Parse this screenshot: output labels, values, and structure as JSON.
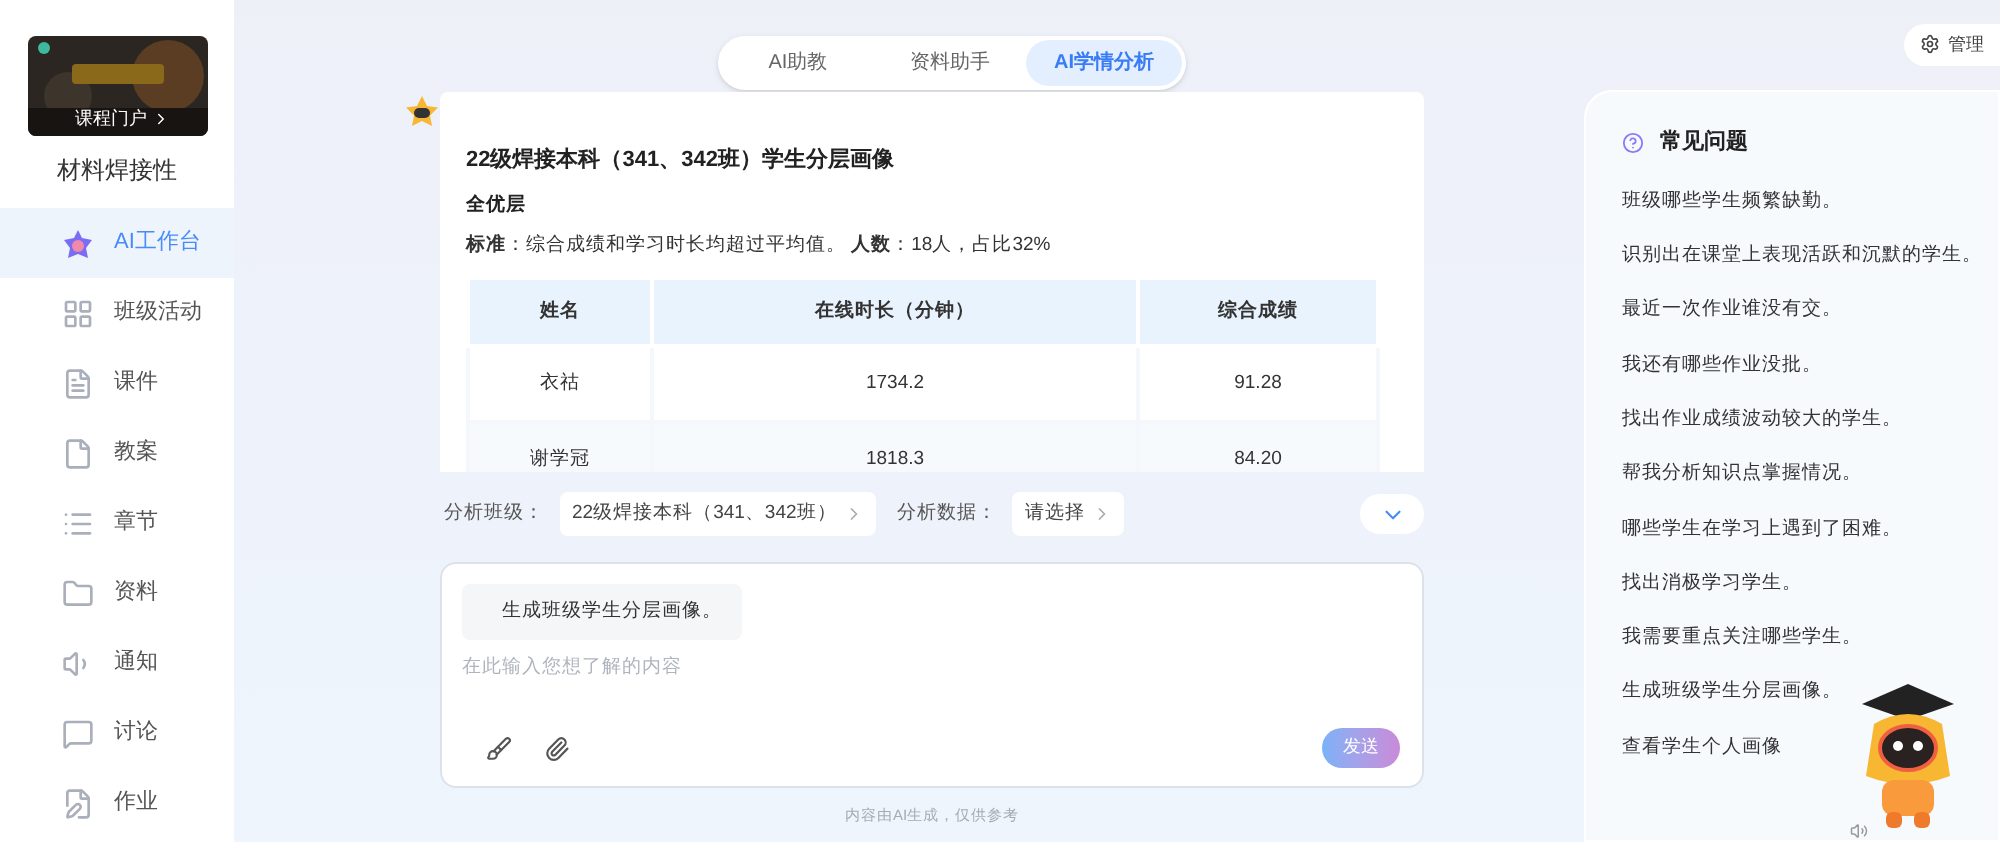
{
  "sidebar": {
    "course_link": "课程门户",
    "course_title": "材料焊接性",
    "items": [
      {
        "label": "AI工作台",
        "selected": true
      },
      {
        "label": "班级活动",
        "selected": false
      },
      {
        "label": "课件",
        "selected": false
      },
      {
        "label": "教案",
        "selected": false
      },
      {
        "label": "章节",
        "selected": false
      },
      {
        "label": "资料",
        "selected": false
      },
      {
        "label": "通知",
        "selected": false
      },
      {
        "label": "讨论",
        "selected": false
      },
      {
        "label": "作业",
        "selected": false
      }
    ]
  },
  "tabs": [
    {
      "label": "AI助教",
      "selected": false
    },
    {
      "label": "资料助手",
      "selected": false
    },
    {
      "label": "AI学情分析",
      "selected": true
    }
  ],
  "manage_button": "管理",
  "report": {
    "title": "22级焊接本科（341、342班）学生分层画像",
    "tier": "全优层",
    "criteria": "**标准**：综合成绩和学习时长均超过平均值。 **人数**：18人，占比32%",
    "table": {
      "columns": [
        "姓名",
        "在线时长（分钟）",
        "综合成绩"
      ],
      "rows": [
        [
          "衣祜",
          "1734.2",
          "91.28"
        ],
        [
          "谢学冠",
          "1818.3",
          "84.20"
        ]
      ]
    }
  },
  "selectors": [
    {
      "label": "分析班级：",
      "value": "22级焊接本科（341、342班）"
    },
    {
      "label": "分析数据：",
      "value": "请选择"
    }
  ],
  "composer": {
    "quoted": "生成班级学生分层画像。",
    "placeholder": "在此输入您想了解的内容",
    "send": "发送"
  },
  "disclaimer": "内容由AI生成，仅供参考",
  "faq": {
    "title": "常见问题",
    "items": [
      "班级哪些学生频繁缺勤。",
      "识别出在课堂上表现活跃和沉默的学生。",
      "最近一次作业谁没有交。",
      "我还有哪些作业没批。",
      "找出作业成绩波动较大的学生。",
      "帮我分析知识点掌握情况。",
      "哪些学生在学习上遇到了困难。",
      "找出消极学习学生。",
      "我需要重点关注哪些学生。",
      "生成班级学生分层画像。",
      "查看学生个人画像"
    ]
  }
}
